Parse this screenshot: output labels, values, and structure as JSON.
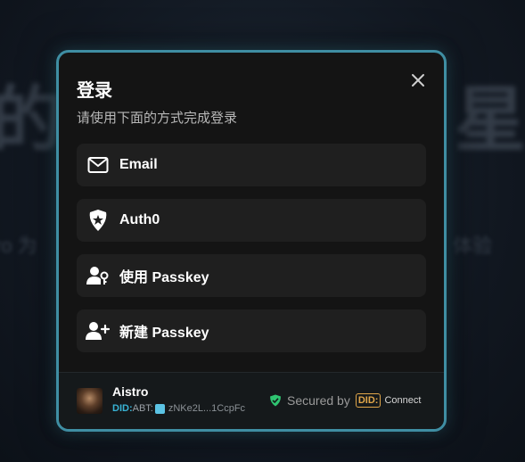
{
  "background": {
    "left_big_text": "的",
    "right_big_text": "星",
    "left_small_text": "ro 为",
    "right_small_text": "体验"
  },
  "dialog": {
    "title": "登录",
    "subtitle": "请使用下面的方式完成登录",
    "close_icon": "close-icon"
  },
  "options": [
    {
      "icon": "mail-icon",
      "label": "Email"
    },
    {
      "icon": "auth0-icon",
      "label": "Auth0"
    },
    {
      "icon": "user-key-icon",
      "label": "使用 Passkey"
    },
    {
      "icon": "user-plus-icon",
      "label": "新建 Passkey"
    }
  ],
  "footer": {
    "app_name": "Aistro",
    "did_prefix": "DID:",
    "did_method": "ABT:",
    "did_address": "zNKe2L...1CcpFc",
    "secured_by": "Secured by",
    "did_badge": "DID:",
    "connect": "Connect"
  },
  "colors": {
    "border_accent": "#3f8ea3",
    "did_blue": "#38b2d4",
    "did_badge_orange": "#e0a64a",
    "shield_green": "#2fc471"
  }
}
